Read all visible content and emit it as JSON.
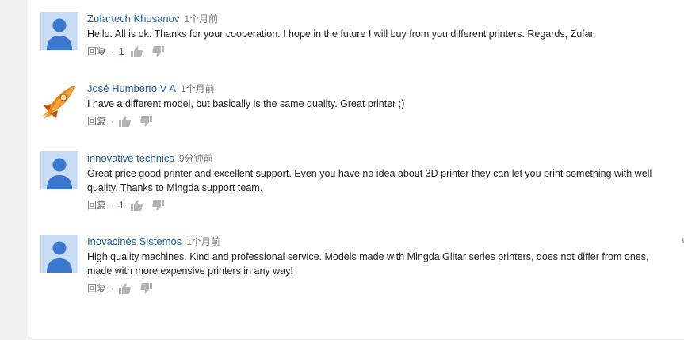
{
  "comments": [
    {
      "author": "Zufartech Khusanov",
      "time": "1个月前",
      "text": "Hello. All is ok. Thanks for your cooperation. I hope in the future I will buy from you different printers. Regards, Zufar.",
      "reply_label": "回复",
      "separator": "·",
      "likes": "1",
      "avatar_icon": "default-user-icon"
    },
    {
      "author": "José Humberto V A",
      "time": "1个月前",
      "text": "I have a different model, but basically is the same quality. Great printer ;)",
      "reply_label": "回复",
      "separator": "·",
      "likes": "",
      "avatar_icon": "rocket-icon"
    },
    {
      "author": "innovative technics",
      "time": "9分钟前",
      "text": "Great price good printer and excellent support. Even you have no idea about 3D printer they can let you print something with well quality. Thanks to Mingda support team.",
      "reply_label": "回复",
      "separator": "·",
      "likes": "1",
      "avatar_icon": "default-user-icon"
    },
    {
      "author": "Inovacinės Sistemos",
      "time": "1个月前",
      "text": "High quality machines. Kind and professional service. Models made with Mingda Glitar series printers, does not differ from ones, made with more expensive printers in any way!",
      "reply_label": "回复",
      "separator": "·",
      "likes": "",
      "avatar_icon": "default-user-icon"
    }
  ],
  "colors": {
    "author": "#1f62a8",
    "meta": "#767676",
    "text": "#222222",
    "avatar_bg": "#c8ddf5",
    "avatar_fg": "#3a78cf"
  },
  "icons": {
    "like": "thumbs-up-icon",
    "dislike": "thumbs-down-icon"
  }
}
